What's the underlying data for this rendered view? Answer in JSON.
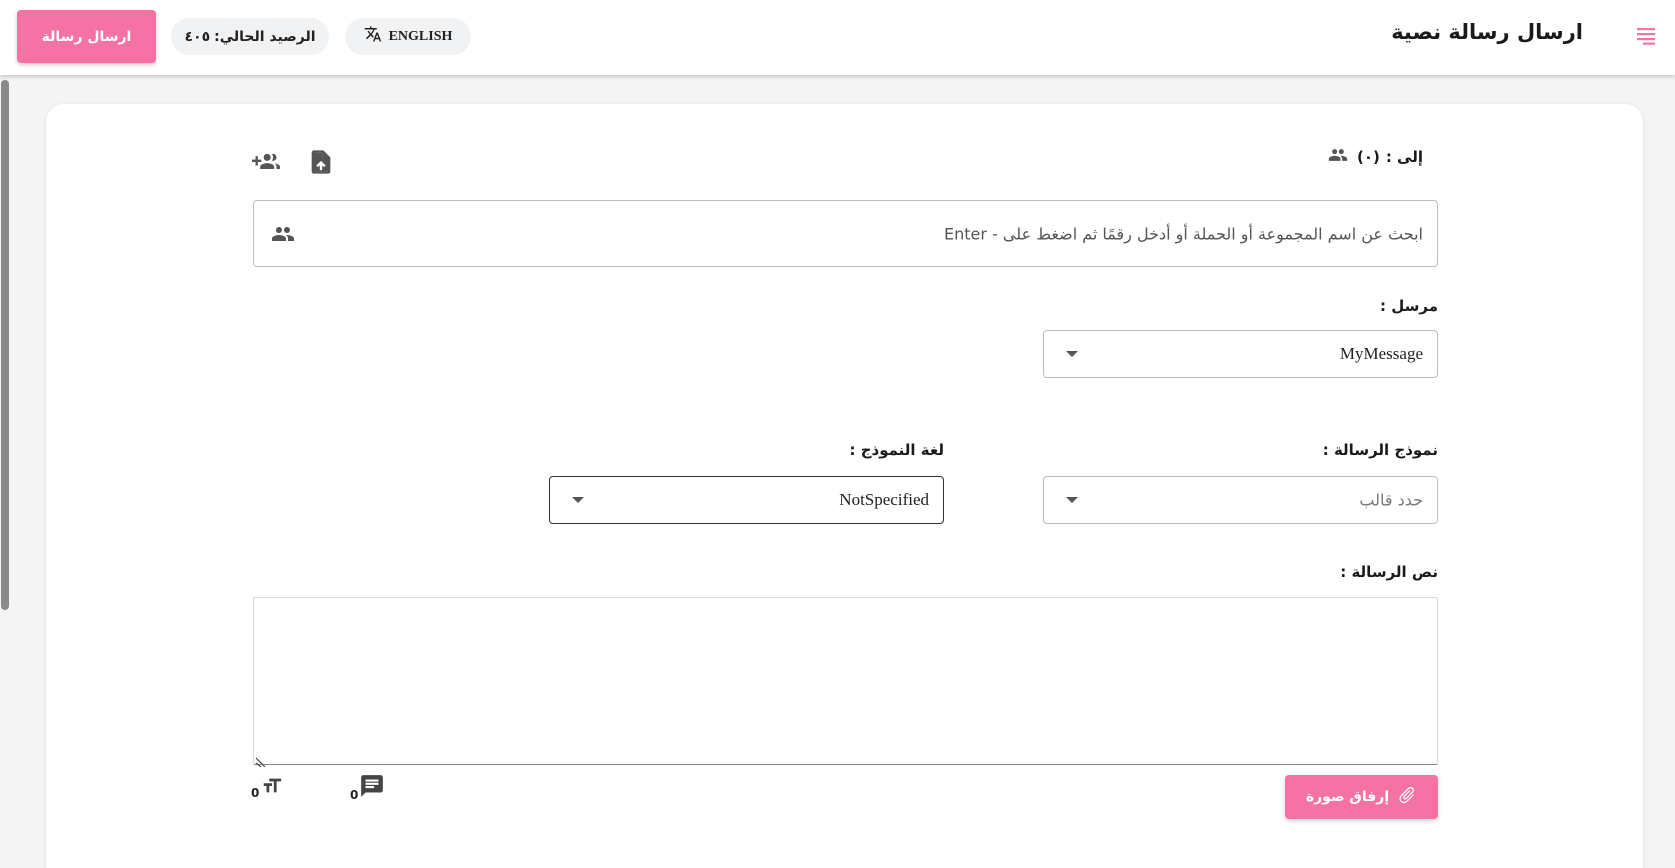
{
  "header": {
    "title": "ارسال رسالة نصية",
    "send_button_label": "ارسال رسالة",
    "balance_label": "الرصيد الحالي:",
    "balance_value": "٤٠٥",
    "language_button_label": "ENGLISH"
  },
  "recipients": {
    "label": "إلى :",
    "count": "(٠)",
    "search_placeholder": "ابحث عن اسم المجموعة أو الحملة أو أدخل رقمًا ثم اضغط على - Enter"
  },
  "sender": {
    "label": "مرسل :",
    "selected_value": "MyMessage"
  },
  "template": {
    "label": "نموذج الرسالة :",
    "placeholder": "حدد قالب"
  },
  "template_language": {
    "label": "لغة النموذج :",
    "selected_value": "NotSpecified"
  },
  "message": {
    "label": "نص الرسالة :",
    "value": "",
    "message_count": "0",
    "character_count": "0"
  },
  "attach_button_label": "إرفاق صورة",
  "colors": {
    "accent": "#f472a4",
    "background": "#f4f4f5",
    "card": "#ffffff"
  },
  "icons": {
    "menu": "menu-lines-icon",
    "language": "translate-icon",
    "group": "group-icon",
    "upload_file": "upload-file-icon",
    "add_group": "group-add-icon",
    "message_count": "sms-icon",
    "text_size": "text-size-icon",
    "attach": "paperclip-icon"
  }
}
